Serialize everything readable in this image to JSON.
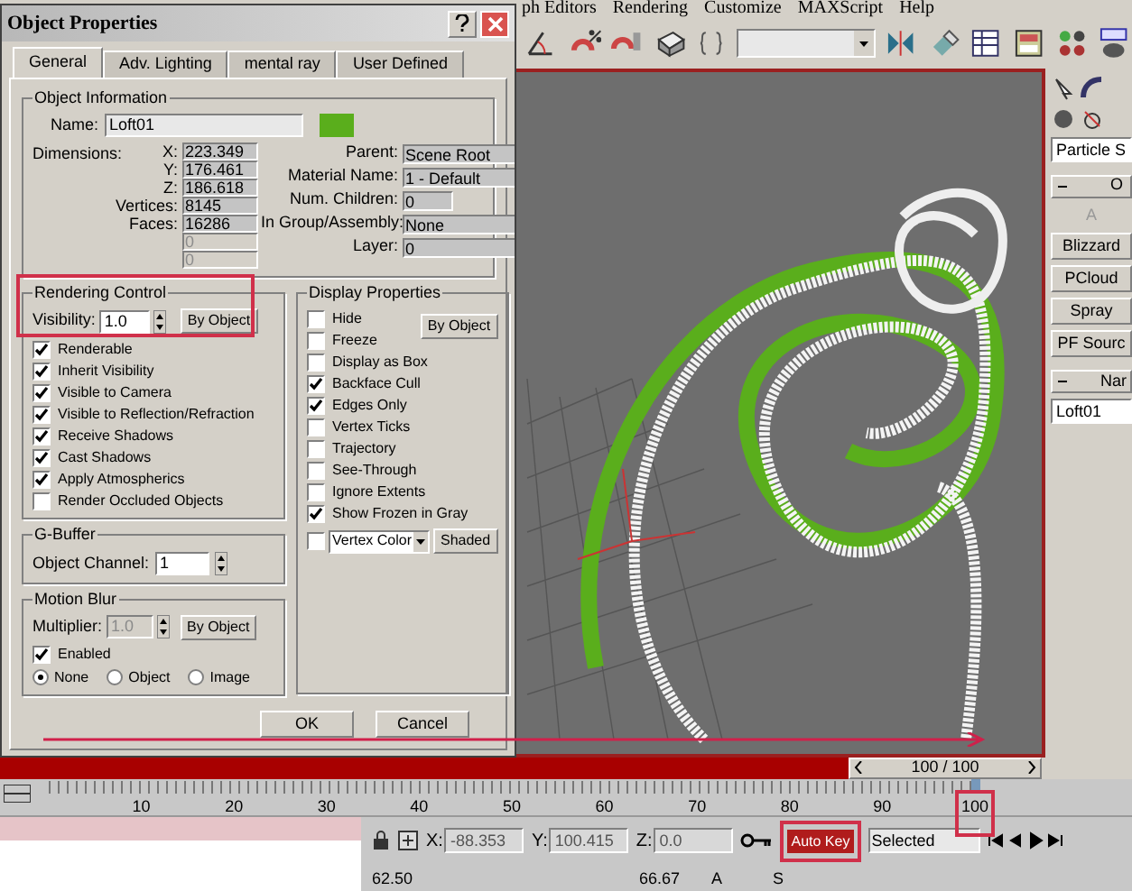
{
  "menu_bar": [
    "ph Editors",
    "Rendering",
    "Customize",
    "MAXScript",
    "Help"
  ],
  "dialog": {
    "title": "Object Properties",
    "tabs": [
      {
        "label": "General",
        "selected": true
      },
      {
        "label": "Adv. Lighting",
        "selected": false
      },
      {
        "label": "mental ray",
        "selected": false
      },
      {
        "label": "User Defined",
        "selected": false
      }
    ],
    "object_information": {
      "title": "Object Information",
      "name_label": "Name:",
      "name": "Loft01",
      "color": "#5aae1c",
      "dimensions_label": "Dimensions:",
      "left_fields": [
        {
          "label": "X:",
          "value": "223.349",
          "disabled": false
        },
        {
          "label": "Y:",
          "value": "176.461",
          "disabled": false
        },
        {
          "label": "Z:",
          "value": "186.618",
          "disabled": false
        },
        {
          "label": "Vertices:",
          "value": "8145",
          "disabled": false
        },
        {
          "label": "Faces:",
          "value": "16286",
          "disabled": false
        },
        {
          "value": "0",
          "disabled": true
        },
        {
          "value": "0",
          "disabled": true
        }
      ],
      "right_fields": [
        {
          "label": "Parent:",
          "value": "Scene Root"
        },
        {
          "label": "Material Name:",
          "value": "1 - Default"
        },
        {
          "label": "Num. Children:",
          "value": "0"
        },
        {
          "label": "In Group/Assembly:",
          "value": "None"
        },
        {
          "label": "Layer:",
          "value": "0"
        }
      ]
    },
    "rendering_control": {
      "title": "Rendering Control",
      "visibility_label": "Visibility:",
      "visibility": "1.0",
      "by_object": "By Object",
      "checks": [
        {
          "label": "Renderable",
          "checked": true
        },
        {
          "label": "Inherit Visibility",
          "checked": true
        },
        {
          "label": "Visible to Camera",
          "checked": true
        },
        {
          "label": "Visible to Reflection/Refraction",
          "checked": true
        },
        {
          "label": "Receive Shadows",
          "checked": true
        },
        {
          "label": "Cast Shadows",
          "checked": true
        },
        {
          "label": "Apply Atmospherics",
          "checked": true
        },
        {
          "label": "Render Occluded Objects",
          "checked": false
        }
      ]
    },
    "display_properties": {
      "title": "Display Properties",
      "by_object": "By Object",
      "checks": [
        {
          "label": "Hide",
          "checked": false
        },
        {
          "label": "Freeze",
          "checked": false
        },
        {
          "label": "Display as Box",
          "checked": false
        },
        {
          "label": "Backface Cull",
          "checked": true
        },
        {
          "label": "Edges Only",
          "checked": true
        },
        {
          "label": "Vertex Ticks",
          "checked": false
        },
        {
          "label": "Trajectory",
          "checked": false
        },
        {
          "label": "See-Through",
          "checked": false
        },
        {
          "label": "Ignore Extents",
          "checked": false
        },
        {
          "label": "Show Frozen in Gray",
          "checked": true
        }
      ],
      "vertex_color": {
        "checked": false,
        "value": "Vertex Color",
        "button": "Shaded"
      }
    },
    "g_buffer": {
      "title": "G-Buffer",
      "label": "Object Channel:",
      "value": "1"
    },
    "motion_blur": {
      "title": "Motion Blur",
      "multiplier_label": "Multiplier:",
      "multiplier": "1.0",
      "by_object": "By Object",
      "enabled": {
        "label": "Enabled",
        "checked": true
      },
      "radios": [
        {
          "label": "None",
          "selected": true
        },
        {
          "label": "Object",
          "selected": false
        },
        {
          "label": "Image",
          "selected": false
        }
      ]
    },
    "buttons": [
      "OK",
      "Cancel"
    ]
  },
  "command_panel": {
    "dropdown": "Particle S",
    "rollouts": [
      "O",
      "Nar"
    ],
    "disabled_label": "A",
    "buttons": [
      "Blizzard",
      "PCloud",
      "Spray",
      "PF Sourc"
    ],
    "name": "Loft01"
  },
  "time_slider": {
    "label": "100 / 100",
    "level": 1
  },
  "ruler_ticks": [
    "10",
    "20",
    "30",
    "40",
    "50",
    "60",
    "70",
    "80",
    "90",
    "100"
  ],
  "coords": [
    {
      "label": "X:",
      "value": "-88.353"
    },
    {
      "label": "Y:",
      "value": "100.415"
    },
    {
      "label": "Z:",
      "value": "0.0"
    }
  ],
  "auto_key": {
    "label": "Auto Key",
    "on": true
  },
  "key_filter": "Selected",
  "status_values": [
    "62.50",
    "66.67",
    "A",
    "S"
  ]
}
